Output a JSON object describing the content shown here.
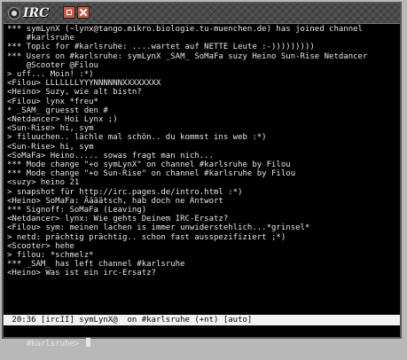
{
  "window": {
    "title": "IRC",
    "app_icon": "irc-logo-icon",
    "buttons": [
      "minimize-icon",
      "close-icon"
    ]
  },
  "log": [
    "*** symLynX (~lynx@tango.mikro.biologie.tu-muenchen.de) has joined channel",
    "    #karlsruhe",
    "*** Topic for #karlsruhe: ....wartet auf NETTE Leute :-)))))))))",
    "*** Users on #karlsruhe: symLynX _SAM_ SoMaFa suzy Heino Sun-Rise Netdancer",
    "    @Scooter @Filou",
    "> uff... Moin! :*)",
    "<Filou> LLLLLLLYYYNNNNNNXXXXXXXX",
    "<Heino> Suzy, wie alt bistn?",
    "<Filou> lynx *freu*",
    "* _SAM_ gruesst den #",
    "<Netdancer> Hoi Lynx ;)",
    "<Sun-Rise> hi, sym",
    "> filuuchen.. lächle mal schön.. du kommst ins web :*)",
    "<Sun-Rise> hi, sym",
    "<SoMaFa> Heino..... sowas fragt man nich...",
    "*** Mode change \"+o symLynX\" on channel #karlsruhe by Filou",
    "*** Mode change \"+o Sun-Rise\" on channel #karlsruhe by Filou",
    "<suzy> heino 21",
    "> snapshot für http://irc.pages.de/intro.html :*)",
    "<Heino> SoMaFa: Äääätsch, hab doch ne Antwort",
    "*** Signoff: SoMaFa (Leaving)",
    "<Netdancer> lynx: Wie gehts Deinem IRC-Ersatz?",
    "<Filou> sym: meinen lachen is immer unwiderstehlich...*grinsel*",
    "> netd: prächtig prächtig.. schon fast ausspezifiziert ;*)",
    "<Scooter> hehe",
    "> filou: *schmelz*",
    "*** _SAM_ has left channel #karlsruhe",
    "<Heino> Was ist ein irc-Ersatz?"
  ],
  "status_line": " 20:36 [ircII] symLynX@  on #karlsruhe (+nt) [auto]",
  "prompt": "#karlsruhe>",
  "input_value": "",
  "colors": {
    "background": "#000000",
    "text": "#e6e6e6",
    "status_bg": "#f2f2f2",
    "title_buttons": "#cc5a4a"
  }
}
